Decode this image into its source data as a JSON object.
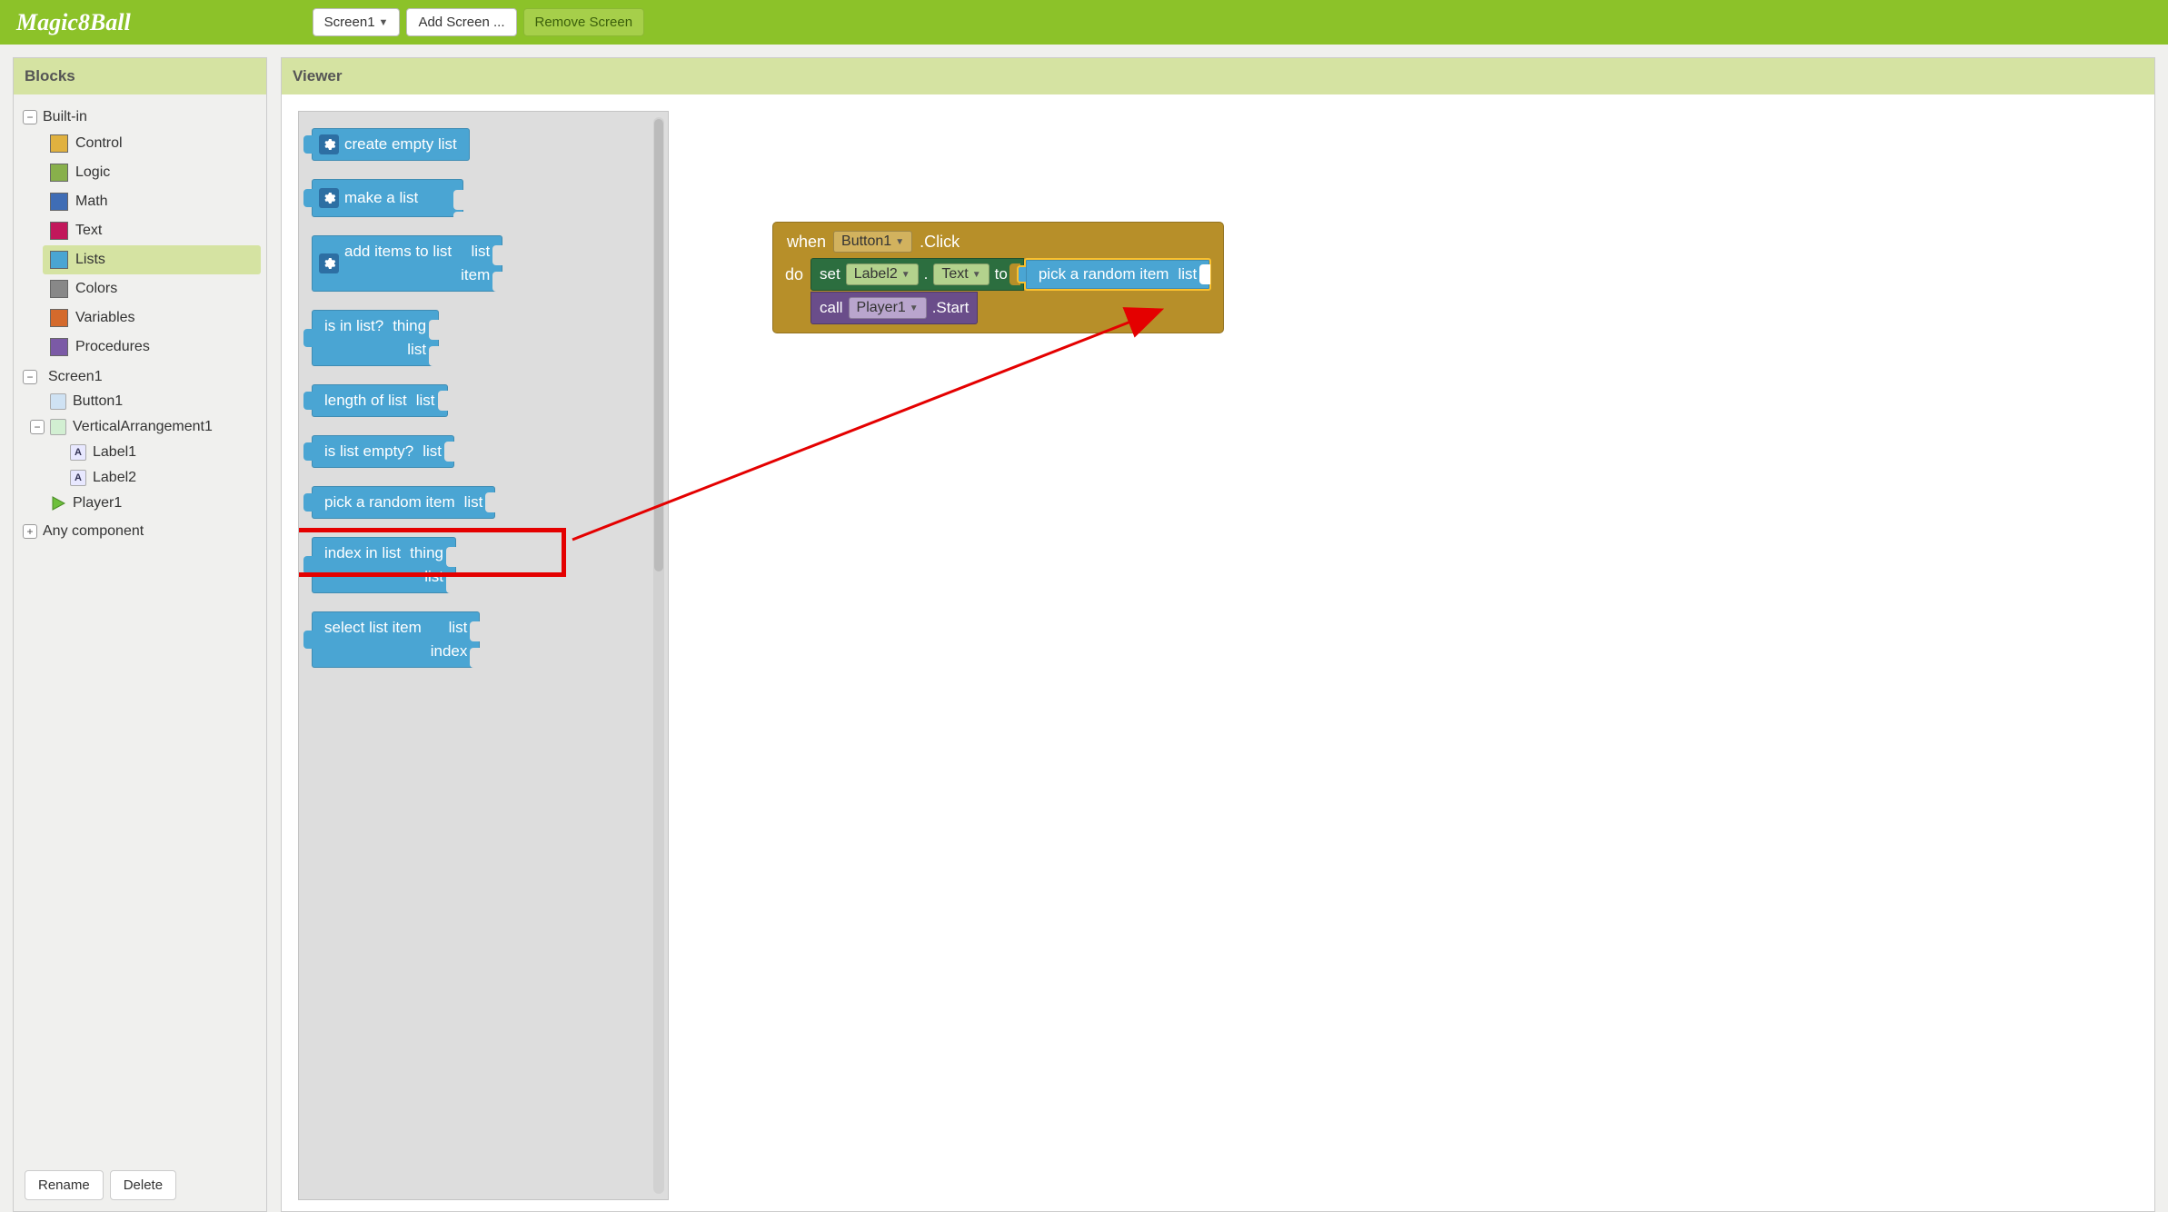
{
  "topbar": {
    "title": "Magic8Ball",
    "screen_btn": "Screen1",
    "add_screen": "Add Screen ...",
    "remove_screen": "Remove Screen"
  },
  "panel": {
    "blocks_header": "Blocks",
    "viewer_header": "Viewer",
    "builtin": "Built-in",
    "categories": {
      "control": "Control",
      "logic": "Logic",
      "math": "Math",
      "text": "Text",
      "lists": "Lists",
      "colors": "Colors",
      "variables": "Variables",
      "procedures": "Procedures"
    },
    "components": {
      "screen1": "Screen1",
      "button1": "Button1",
      "va1": "VerticalArrangement1",
      "label1": "Label1",
      "label2": "Label2",
      "player1": "Player1"
    },
    "any_component": "Any component",
    "rename": "Rename",
    "delete": "Delete"
  },
  "flyout": {
    "create_empty": "create empty list",
    "make_list": "make a list",
    "add_items": "add items to list",
    "add_items_p1": "list",
    "add_items_p2": "item",
    "is_in_list": "is in list?",
    "thing": "thing",
    "list": "list",
    "length": "length of list",
    "is_empty": "is list empty?",
    "pick_random": "pick a random item",
    "index_in": "index in list",
    "select_item": "select list item",
    "index": "index"
  },
  "ws": {
    "when": "when",
    "click": ".Click",
    "do": "do",
    "set": "set",
    "to": "to",
    "dot": ".",
    "text": "Text",
    "call": "call",
    "start": ".Start",
    "button1": "Button1",
    "label2": "Label2",
    "player1": "Player1",
    "pick": "pick a random item",
    "picklist": "list"
  }
}
